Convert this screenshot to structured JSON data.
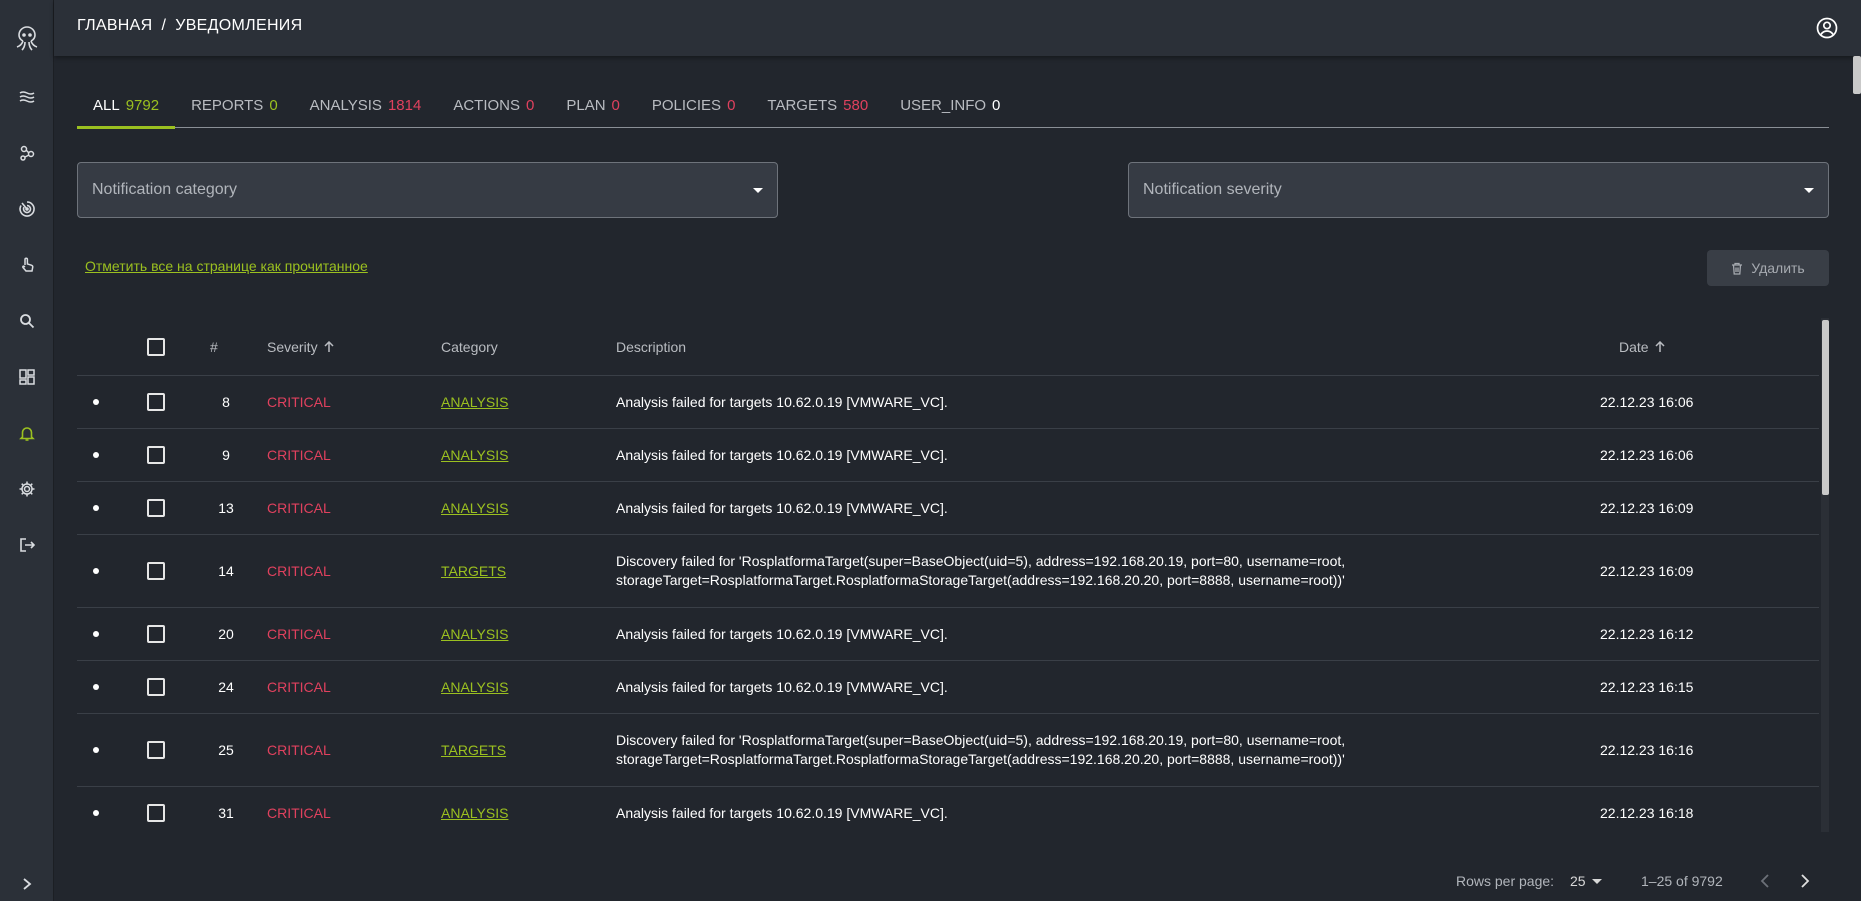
{
  "header": {
    "breadcrumb_home": "ГЛАВНАЯ",
    "breadcrumb_sep": "/",
    "breadcrumb_current": "УВЕДОМЛЕНИЯ"
  },
  "sidebar": {
    "items": [
      "layers-icon",
      "nodes-icon",
      "target-icon",
      "pointer-icon",
      "search-icon",
      "dashboard-icon",
      "bell-icon",
      "gear-icon",
      "logout-icon"
    ],
    "active": "bell-icon"
  },
  "tabs": [
    {
      "label": "ALL",
      "count": "9792",
      "color": "green",
      "active": true
    },
    {
      "label": "REPORTS",
      "count": "0",
      "color": "green"
    },
    {
      "label": "ANALYSIS",
      "count": "1814",
      "color": "red"
    },
    {
      "label": "ACTIONS",
      "count": "0",
      "color": "red"
    },
    {
      "label": "PLAN",
      "count": "0",
      "color": "red"
    },
    {
      "label": "POLICIES",
      "count": "0",
      "color": "red"
    },
    {
      "label": "TARGETS",
      "count": "580",
      "color": "red"
    },
    {
      "label": "USER_INFO",
      "count": "0",
      "color": "white"
    }
  ],
  "filters": {
    "category_placeholder": "Notification category",
    "severity_placeholder": "Notification severity"
  },
  "actions": {
    "mark_all_read": "Отметить все на странице как прочитанное",
    "delete_label": "Удалить"
  },
  "table": {
    "headers": {
      "num": "#",
      "severity": "Severity",
      "category": "Category",
      "description": "Description",
      "date": "Date"
    },
    "rows": [
      {
        "num": "8",
        "severity": "CRITICAL",
        "category": "ANALYSIS",
        "desc1": "Analysis failed for targets 10.62.0.19 [VMWARE_VC].",
        "desc2": "",
        "date": "22.12.23 16:06"
      },
      {
        "num": "9",
        "severity": "CRITICAL",
        "category": "ANALYSIS",
        "desc1": "Analysis failed for targets 10.62.0.19 [VMWARE_VC].",
        "desc2": "",
        "date": "22.12.23 16:06"
      },
      {
        "num": "13",
        "severity": "CRITICAL",
        "category": "ANALYSIS",
        "desc1": "Analysis failed for targets 10.62.0.19 [VMWARE_VC].",
        "desc2": "",
        "date": "22.12.23 16:09"
      },
      {
        "num": "14",
        "severity": "CRITICAL",
        "category": "TARGETS",
        "desc1": "Discovery failed for 'RosplatformaTarget(super=BaseObject(uid=5), address=192.168.20.19, port=80, username=root,",
        "desc2": "storageTarget=RosplatformaTarget.RosplatformaStorageTarget(address=192.168.20.20, port=8888, username=root))'",
        "date": "22.12.23 16:09"
      },
      {
        "num": "20",
        "severity": "CRITICAL",
        "category": "ANALYSIS",
        "desc1": "Analysis failed for targets 10.62.0.19 [VMWARE_VC].",
        "desc2": "",
        "date": "22.12.23 16:12"
      },
      {
        "num": "24",
        "severity": "CRITICAL",
        "category": "ANALYSIS",
        "desc1": "Analysis failed for targets 10.62.0.19 [VMWARE_VC].",
        "desc2": "",
        "date": "22.12.23 16:15"
      },
      {
        "num": "25",
        "severity": "CRITICAL",
        "category": "TARGETS",
        "desc1": "Discovery failed for 'RosplatformaTarget(super=BaseObject(uid=5), address=192.168.20.19, port=80, username=root,",
        "desc2": "storageTarget=RosplatformaTarget.RosplatformaStorageTarget(address=192.168.20.20, port=8888, username=root))'",
        "date": "22.12.23 16:16"
      },
      {
        "num": "31",
        "severity": "CRITICAL",
        "category": "ANALYSIS",
        "desc1": "Analysis failed for targets 10.62.0.19 [VMWARE_VC].",
        "desc2": "",
        "date": "22.12.23 16:18"
      }
    ]
  },
  "pagination": {
    "rows_per_page_label": "Rows per page:",
    "rows_per_page": "25",
    "range": "1–25 of 9792"
  },
  "colors": {
    "accent": "#9bc020",
    "critical": "#e0415e",
    "background": "#22262d",
    "panel": "#2b3038"
  }
}
